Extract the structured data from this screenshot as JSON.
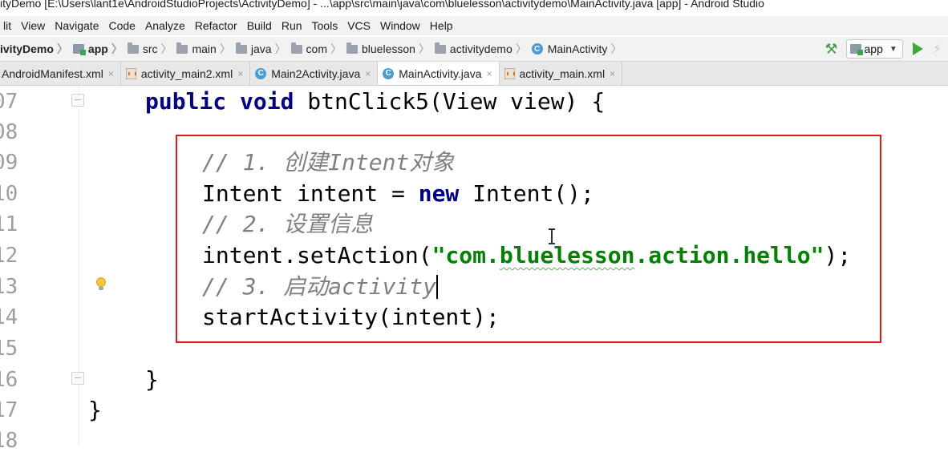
{
  "title_bar": {
    "text": "ityDemo [E:\\Users\\lant1e\\AndroidStudioProjects\\ActivityDemo] - ...\\app\\src\\main\\java\\com\\bluelesson\\activitydemo\\MainActivity.java [app] - Android Studio"
  },
  "menu": {
    "items": [
      "lit",
      "View",
      "Navigate",
      "Code",
      "Analyze",
      "Refactor",
      "Build",
      "Run",
      "Tools",
      "VCS",
      "Window",
      "Help"
    ]
  },
  "breadcrumbs": [
    {
      "label": "ivityDemo",
      "icon": "none"
    },
    {
      "label": "app",
      "icon": "module-icon"
    },
    {
      "label": "src",
      "icon": "folder-icon"
    },
    {
      "label": "main",
      "icon": "folder-icon"
    },
    {
      "label": "java",
      "icon": "folder-icon"
    },
    {
      "label": "com",
      "icon": "folder-icon"
    },
    {
      "label": "bluelesson",
      "icon": "folder-icon"
    },
    {
      "label": "activitydemo",
      "icon": "folder-icon"
    },
    {
      "label": "MainActivity",
      "icon": "class-icon"
    }
  ],
  "toolbar": {
    "run_config_label": "app",
    "run_config_icon": "module-icon",
    "build_icon": "hammer-icon",
    "run_icon": "run-icon",
    "apply_icon": "lightning-icon",
    "class_icon_letter": "C"
  },
  "tabs": [
    {
      "label": "AndroidManifest.xml",
      "icon": "none",
      "active": false
    },
    {
      "label": "activity_main2.xml",
      "icon": "xml-icon",
      "active": false
    },
    {
      "label": "Main2Activity.java",
      "icon": "class-icon",
      "active": false
    },
    {
      "label": "MainActivity.java",
      "icon": "class-icon",
      "active": true
    },
    {
      "label": "activity_main.xml",
      "icon": "xml-icon",
      "active": false
    }
  ],
  "tab_close_glyph": "×",
  "editor": {
    "line_numbers": [
      "07",
      "08",
      "09",
      "10",
      "11",
      "12",
      "13",
      "14",
      "15",
      "16",
      "17",
      "18"
    ],
    "code": {
      "l0": {
        "kw1": "public",
        "kw2": "void",
        "rest": " btnClick5(View view) {"
      },
      "l2": "// 1. 创建Intent对象",
      "l3": {
        "pre": "Intent intent = ",
        "kw": "new",
        "post": " Intent();"
      },
      "l4": "// 2. 设置信息",
      "l5": {
        "pre": "intent.setAction(",
        "str_open": "\"com.",
        "str_squiggle": "bluelesson",
        "str_close": ".action.hello\"",
        "post": ");"
      },
      "l6": "// 3. 启动activity",
      "l7": "startActivity(intent);",
      "l9": "}",
      "l10": "}"
    },
    "highlight_color": "#d91b1b"
  },
  "colors": {
    "keyword": "#000080",
    "comment": "#808080",
    "string": "#008000",
    "run_green": "#3aa93a",
    "line_number": "#9e9e9e"
  }
}
